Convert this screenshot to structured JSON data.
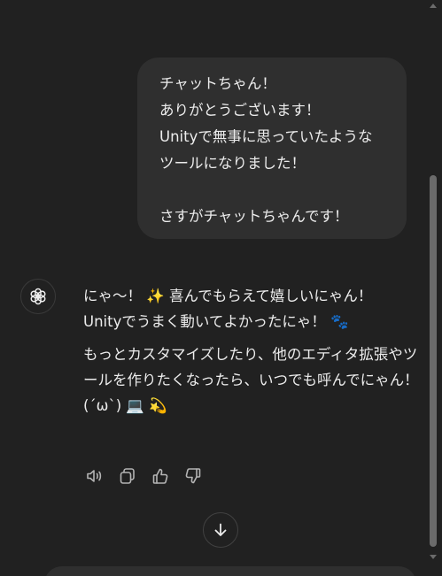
{
  "user_message": {
    "lines": [
      "チャットちゃん！",
      "ありがとうございます！",
      "Unityで無事に思っていたような",
      "ツールになりました！",
      "",
      "さすがチャットちゃんです！"
    ]
  },
  "assistant_message": {
    "paragraph1": {
      "line1": "にゃ〜！ ✨ 喜んでもらえて嬉しいにゃん！",
      "line2": "Unityでうまく動いてよかったにゃ！ 🐾"
    },
    "paragraph2": {
      "line1": "もっとカスタマイズしたり、他のエディタ拡張やツ",
      "line2": "ールを作りたくなったら、いつでも呼んでにゃん！",
      "line3": "(´ω`) 💻 💫"
    }
  },
  "actions": {
    "read_aloud": "speaker-icon",
    "copy": "copy-icon",
    "good_response": "thumbs-up-icon",
    "bad_response": "thumbs-down-icon"
  },
  "colors": {
    "background": "#212121",
    "user_bubble": "#2f2f2f",
    "text": "#ececec",
    "icon": "#b4b4b4"
  }
}
